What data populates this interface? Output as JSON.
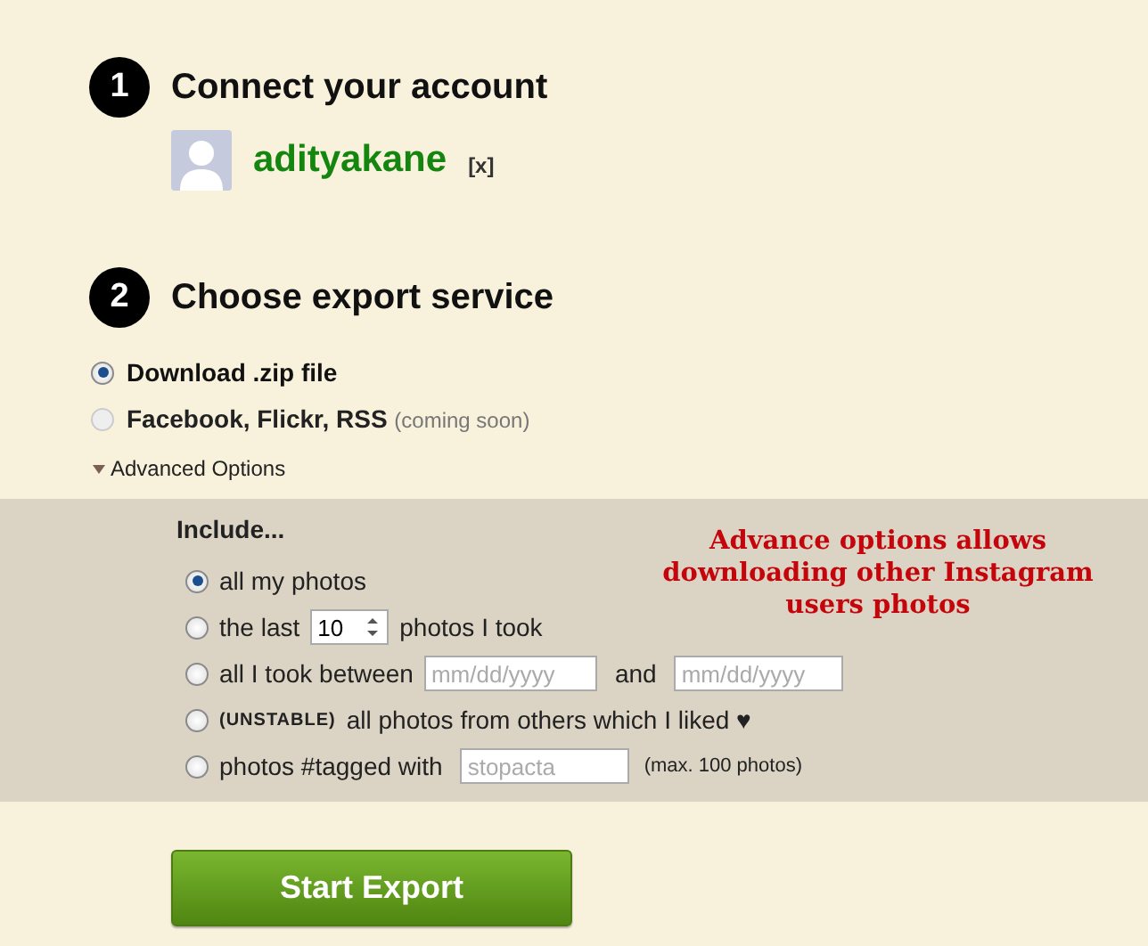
{
  "steps": [
    {
      "number": "1",
      "title": "Connect your account"
    },
    {
      "number": "2",
      "title": "Choose export service"
    }
  ],
  "account": {
    "username": "adityakane",
    "remove": "[x]"
  },
  "services": [
    {
      "label": "Download .zip file",
      "selected": true,
      "disabled": false
    },
    {
      "label": "Facebook, Flickr, RSS",
      "note": "(coming soon)",
      "selected": false,
      "disabled": true
    }
  ],
  "advanced_toggle": {
    "label": "Advanced Options",
    "expanded": true
  },
  "include": {
    "title": "Include...",
    "options": [
      {
        "kind": "plain",
        "label": "all my photos",
        "selected": true
      },
      {
        "kind": "count",
        "before": "the last",
        "value": "10",
        "after": "photos I took",
        "selected": false
      },
      {
        "kind": "range",
        "before": "all I took between",
        "from_placeholder": "mm/dd/yyyy",
        "middle": "and",
        "to_placeholder": "mm/dd/yyyy",
        "selected": false
      },
      {
        "kind": "flagged",
        "flag": "(UNSTABLE)",
        "label": "all photos from others which I liked ♥",
        "selected": false
      },
      {
        "kind": "tag",
        "before": "photos #tagged with",
        "placeholder": "stopacta",
        "note": "(max. 100 photos)",
        "selected": false
      }
    ]
  },
  "annotation": "Advance options allows downloading other Instagram users photos",
  "start_button": "Start Export"
}
